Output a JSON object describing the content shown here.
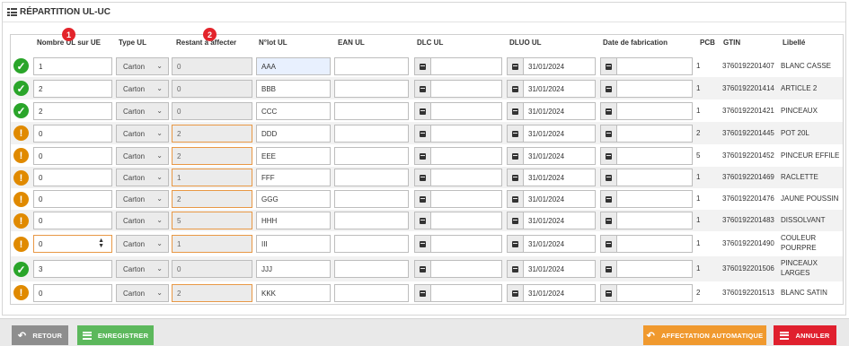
{
  "panel": {
    "title": "RÉPARTITION UL-UC"
  },
  "headers": {
    "nb_ul": "Nombre UL sur UE",
    "type_ul": "Type UL",
    "restant": "Restant à affecter",
    "nlot": "N°lot UL",
    "ean": "EAN UL",
    "dlc": "DLC UL",
    "dluo": "DLUO UL",
    "date_fab": "Date de fabrication",
    "pcb": "PCB",
    "gtin": "GTIN",
    "libelle": "Libellé"
  },
  "badges": {
    "b1": "1",
    "b2": "2"
  },
  "rows": [
    {
      "status": "ok",
      "nb": "1",
      "type": "Carton",
      "restant": "0",
      "lot": "AAA",
      "dluo": "31/01/2024",
      "pcb": "1",
      "gtin": "3760192201407",
      "libelle": "BLANC CASSE"
    },
    {
      "status": "ok",
      "nb": "2",
      "type": "Carton",
      "restant": "0",
      "lot": "BBB",
      "dluo": "31/01/2024",
      "pcb": "1",
      "gtin": "3760192201414",
      "libelle": "ARTICLE 2"
    },
    {
      "status": "ok",
      "nb": "2",
      "type": "Carton",
      "restant": "0",
      "lot": "CCC",
      "dluo": "31/01/2024",
      "pcb": "1",
      "gtin": "3760192201421",
      "libelle": "PINCEAUX"
    },
    {
      "status": "warn",
      "nb": "0",
      "type": "Carton",
      "restant": "2",
      "lot": "DDD",
      "dluo": "31/01/2024",
      "pcb": "2",
      "gtin": "3760192201445",
      "libelle": "POT 20L"
    },
    {
      "status": "warn",
      "nb": "0",
      "type": "Carton",
      "restant": "2",
      "lot": "EEE",
      "dluo": "31/01/2024",
      "pcb": "5",
      "gtin": "3760192201452",
      "libelle": "PINCEUR EFFILE"
    },
    {
      "status": "warn",
      "nb": "0",
      "type": "Carton",
      "restant": "1",
      "lot": "FFF",
      "dluo": "31/01/2024",
      "pcb": "1",
      "gtin": "3760192201469",
      "libelle": "RACLETTE"
    },
    {
      "status": "warn",
      "nb": "0",
      "type": "Carton",
      "restant": "2",
      "lot": "GGG",
      "dluo": "31/01/2024",
      "pcb": "1",
      "gtin": "3760192201476",
      "libelle": "JAUNE POUSSIN"
    },
    {
      "status": "warn",
      "nb": "0",
      "type": "Carton",
      "restant": "5",
      "lot": "HHH",
      "dluo": "31/01/2024",
      "pcb": "1",
      "gtin": "3760192201483",
      "libelle": "DISSOLVANT"
    },
    {
      "status": "warn",
      "nb": "0",
      "type": "Carton",
      "restant": "1",
      "lot": "III",
      "dluo": "31/01/2024",
      "pcb": "1",
      "gtin": "3760192201490",
      "libelle": "COULEUR POURPRE"
    },
    {
      "status": "ok",
      "nb": "3",
      "type": "Carton",
      "restant": "0",
      "lot": "JJJ",
      "dluo": "31/01/2024",
      "pcb": "1",
      "gtin": "3760192201506",
      "libelle": "PINCEAUX LARGES"
    },
    {
      "status": "warn",
      "nb": "0",
      "type": "Carton",
      "restant": "2",
      "lot": "KKK",
      "dluo": "31/01/2024",
      "pcb": "2",
      "gtin": "3760192201513",
      "libelle": "BLANC SATIN"
    }
  ],
  "footer": {
    "back": "RETOUR",
    "save": "ENREGISTRER",
    "auto": "AFFECTATION AUTOMATIQUE",
    "cancel": "ANNULER"
  },
  "colors": {
    "ok": "#2aa52a",
    "warn": "#e08a00",
    "badge": "#e3242b",
    "save": "#5cb85c",
    "auto": "#f0992e",
    "cancel": "#e0202e",
    "back": "#8e8e8e"
  },
  "icons": {
    "title": "list-icon",
    "ok": "check-circle-icon",
    "warn": "exclamation-circle-icon",
    "calendar": "calendar-icon",
    "select": "chevron-down-icon",
    "back": "undo-arrow-icon",
    "save": "lines-icon",
    "auto": "undo-arrow-icon",
    "cancel": "lines-icon"
  }
}
